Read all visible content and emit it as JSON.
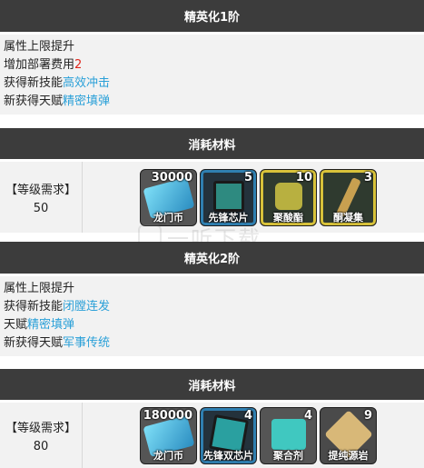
{
  "elite1": {
    "title": "精英化1阶",
    "lines": [
      {
        "prefix": "属性上限提升",
        "value": "",
        "suffix": ""
      },
      {
        "prefix": "增加部署费用",
        "value": "2",
        "suffix": ""
      },
      {
        "prefix": "获得新技能",
        "value": "高效冲击",
        "suffix": ""
      },
      {
        "prefix": "新获得天赋",
        "value": "精密填弹",
        "suffix": ""
      }
    ],
    "materials_title": "消耗材料",
    "requirement_label": "【等级需求】",
    "requirement_level": "50",
    "items": [
      {
        "name": "龙门币",
        "qty": "30000",
        "icon": "lmd-icon",
        "color": "#58c8e8"
      },
      {
        "name": "先锋芯片",
        "qty": "5",
        "icon": "vanguard-chip-icon",
        "color": "#2e8a80"
      },
      {
        "name": "聚酸酯",
        "qty": "10",
        "icon": "polyester-icon",
        "color": "#b8b040"
      },
      {
        "name": "酮凝集",
        "qty": "3",
        "icon": "oriron-icon",
        "color": "#c8a050"
      }
    ]
  },
  "elite2": {
    "title": "精英化2阶",
    "lines": [
      {
        "prefix": "属性上限提升",
        "value": "",
        "suffix": ""
      },
      {
        "prefix": "获得新技能",
        "value": "闭膛连发",
        "suffix": ""
      },
      {
        "prefix": "天赋",
        "value": "精密填弹",
        "suffix": ""
      },
      {
        "prefix": "新获得天赋",
        "value": "军事传统",
        "suffix": ""
      }
    ],
    "materials_title": "消耗材料",
    "requirement_label": "【等级需求】",
    "requirement_level": "80",
    "items": [
      {
        "name": "龙门币",
        "qty": "180000",
        "icon": "lmd-icon",
        "color": "#58c8e8"
      },
      {
        "name": "先锋双芯片",
        "qty": "4",
        "icon": "vanguard-dualchip-icon",
        "color": "#2aa0a0"
      },
      {
        "name": "聚合剂",
        "qty": "4",
        "icon": "polymerization-icon",
        "color": "#40c8c0"
      },
      {
        "name": "提纯源岩",
        "qty": "9",
        "icon": "orirock-concentration-icon",
        "color": "#d8b878"
      }
    ]
  },
  "watermark": {
    "text": "一听下载"
  }
}
